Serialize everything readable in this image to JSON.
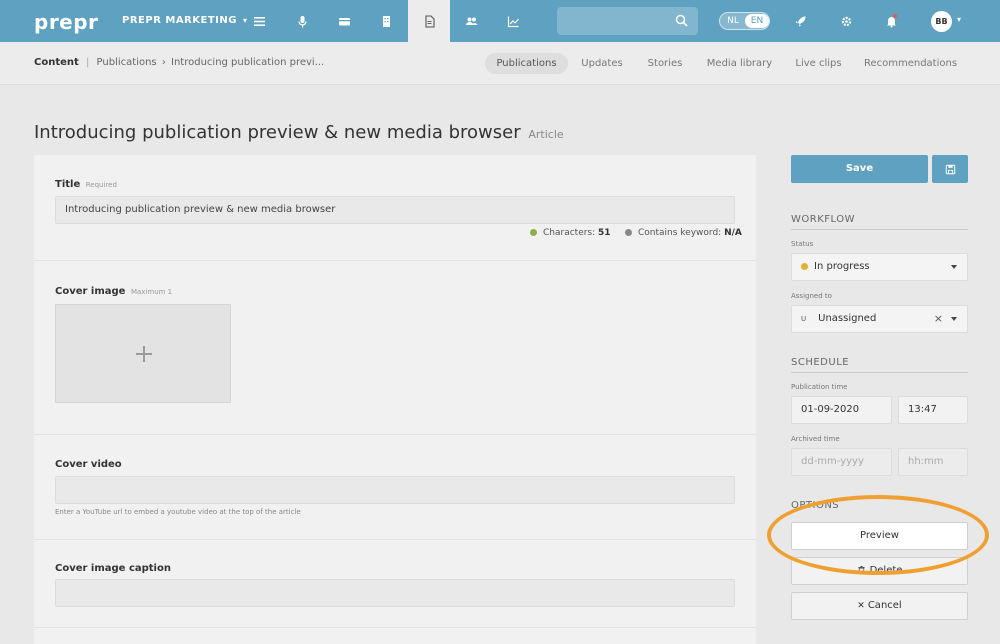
{
  "topnav": {
    "logo": "prepr",
    "environment": "PREPR MARKETING",
    "environment_caret": "▾",
    "lang_nl": "NL",
    "lang_en": "EN",
    "avatar": "BB",
    "avatar_caret": "▾",
    "accent": "#5fa1c0"
  },
  "breadcrumb": {
    "root": "Content",
    "sep1": "|",
    "parent": "Publications",
    "sep2": "›",
    "current": "Introducing publication previ..."
  },
  "subtabs": [
    "Publications",
    "Updates",
    "Stories",
    "Media library",
    "Live clips",
    "Recommendations"
  ],
  "page": {
    "title": "Introducing publication preview & new media browser",
    "type": "Article"
  },
  "fields": {
    "title_label": "Title",
    "title_hint": "Required",
    "title_value": "Introducing publication preview & new media browser",
    "characters_label": "Characters:",
    "characters_value": "51",
    "keyword_label": "Contains keyword:",
    "keyword_value": "N/A",
    "characters_color": "#8ab04a",
    "keyword_color": "#888888",
    "cover_image_label": "Cover image",
    "cover_image_hint": "Maximum 1",
    "cover_video_label": "Cover video",
    "cover_video_help": "Enter a YouTube url to embed a youtube video at the top of the article",
    "cover_caption_label": "Cover image caption"
  },
  "sidebar": {
    "save_label": "Save",
    "workflow_heading": "WORKFLOW",
    "status_label": "Status",
    "status_value": "In progress",
    "status_color": "#e0b030",
    "assigned_label": "Assigned to",
    "assigned_badge": "U",
    "assigned_value": "Unassigned",
    "clear_symbol": "×",
    "schedule_heading": "SCHEDULE",
    "publication_label": "Publication time",
    "publication_date": "01-09-2020",
    "publication_time": "13:47",
    "archived_label": "Archived time",
    "archived_date_placeholder": "dd-mm-yyyy",
    "archived_time_placeholder": "hh:mm",
    "options_heading": "OPTIONS",
    "preview_label": "Preview",
    "delete_label": "Delete",
    "cancel_label": "Cancel",
    "cancel_symbol": "✕"
  }
}
